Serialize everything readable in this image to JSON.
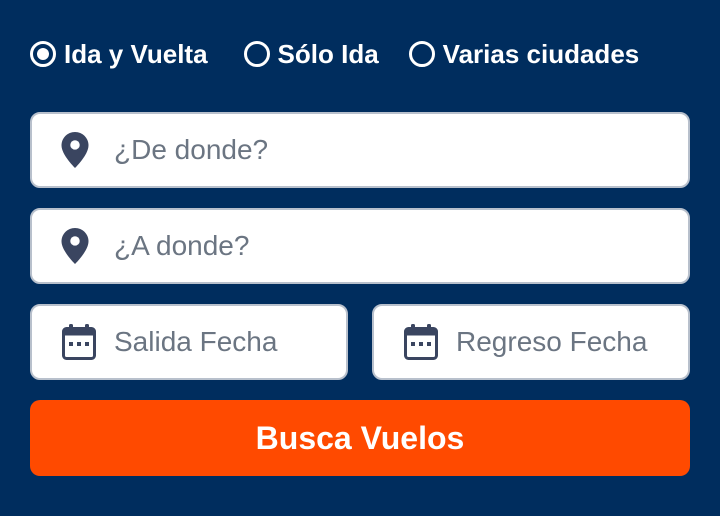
{
  "trip_types": {
    "options": [
      {
        "label": "Ida y Vuelta",
        "selected": true
      },
      {
        "label": "Sólo Ida",
        "selected": false
      },
      {
        "label": "Varias ciudades",
        "selected": false
      }
    ]
  },
  "origin": {
    "placeholder": "¿De donde?",
    "icon": "map-pin-icon"
  },
  "destination": {
    "placeholder": "¿A donde?",
    "icon": "map-pin-icon"
  },
  "departure_date": {
    "placeholder": "Salida Fecha",
    "icon": "calendar-icon"
  },
  "return_date": {
    "placeholder": "Regreso Fecha",
    "icon": "calendar-icon"
  },
  "search_button": {
    "label": "Busca Vuelos"
  },
  "colors": {
    "background": "#002d5e",
    "accent": "#ff4a00",
    "icon": "#3a4560",
    "placeholder": "#6b7582"
  }
}
